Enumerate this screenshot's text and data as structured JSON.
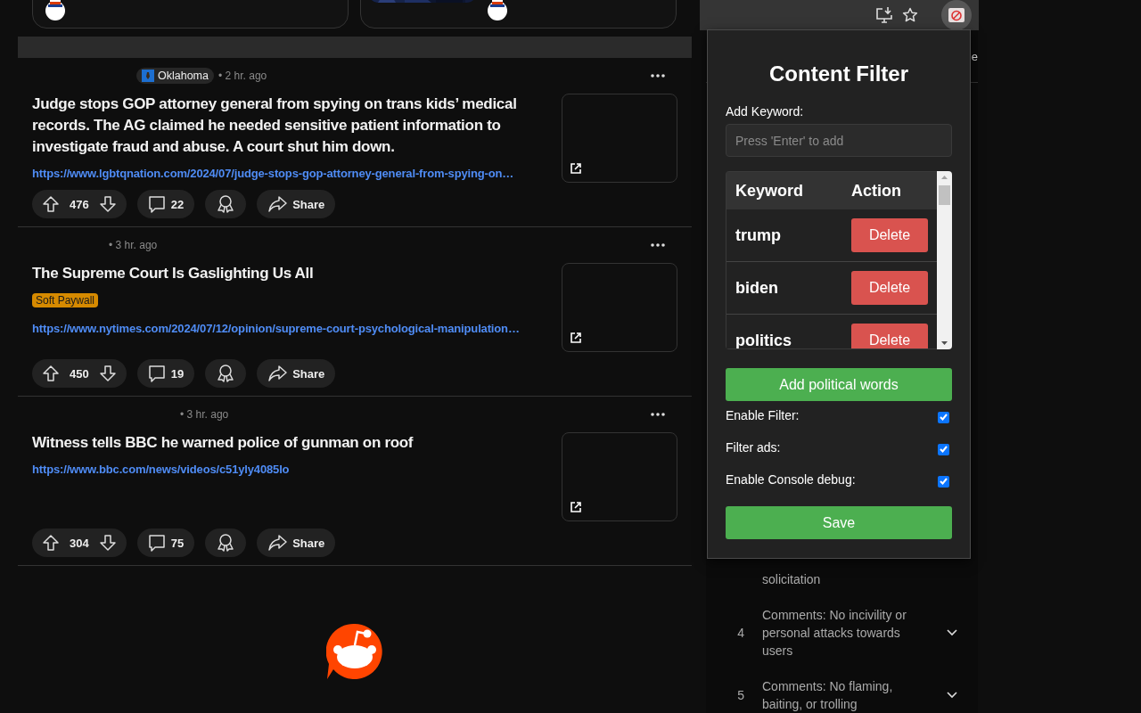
{
  "top_cards": [
    {
      "has_picture": false
    },
    {
      "has_picture": true
    }
  ],
  "posts": [
    {
      "subreddit": "Oklahoma",
      "time": "• 2 hr. ago",
      "title": "Judge stops GOP attorney general from spying on trans kids’ medical records. The AG claimed he needed sensitive patient information to investigate fraud and abuse. A court shut him down.",
      "url": "https://www.lgbtqnation.com/2024/07/judge-stops-gop-attorney-general-from-spying-on…",
      "votes": "476",
      "comments": "22",
      "share": "Share"
    },
    {
      "time": "• 3 hr. ago",
      "title": "The Supreme Court Is Gaslighting Us All",
      "tag": "Soft Paywall",
      "url": "https://www.nytimes.com/2024/07/12/opinion/supreme-court-psychological-manipulation…",
      "votes": "450",
      "comments": "19",
      "share": "Share"
    },
    {
      "time": "• 3 hr. ago",
      "title": "Witness tells BBC he warned police of gunman on roof",
      "url": "https://www.bbc.com/news/videos/c51yly4085lo",
      "votes": "304",
      "comments": "75",
      "share": "Share"
    }
  ],
  "sidebar": {
    "fragment": "e",
    "rules": [
      {
        "kind": "continuation",
        "text": "solicitation"
      },
      {
        "kind": "rule",
        "number": "4",
        "text": "Comments: No incivility or personal attacks towards users",
        "expanded": false
      },
      {
        "kind": "rule",
        "number": "5",
        "text": "Comments: No flaming, baiting, or trolling",
        "expanded": false
      }
    ]
  },
  "popup": {
    "title": "Content Filter",
    "keyword_label": "Add Keyword:",
    "keyword_placeholder": "Press 'Enter' to add",
    "columns": [
      "Keyword",
      "Action"
    ],
    "keywords": [
      {
        "keyword": "trump",
        "action": "Delete"
      },
      {
        "keyword": "biden",
        "action": "Delete"
      },
      {
        "keyword": "politics",
        "action": "Delete"
      }
    ],
    "add_button": "Add political words",
    "options": [
      {
        "label": "Enable Filter:",
        "checked": true
      },
      {
        "label": "Filter ads:",
        "checked": true
      },
      {
        "label": "Enable Console debug:",
        "checked": true
      }
    ],
    "save_button": "Save"
  }
}
